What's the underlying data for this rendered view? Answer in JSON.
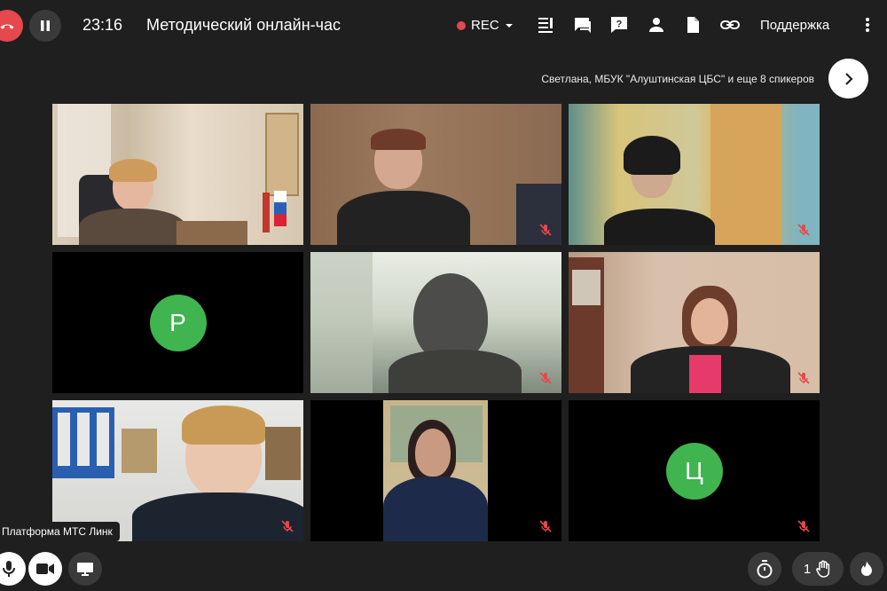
{
  "header": {
    "timer": "23:16",
    "title": "Методический онлайн-час",
    "rec_label": "REC",
    "support_label": "Поддержка",
    "icons": [
      "end-call-icon",
      "pause-icon",
      "chevron-down-icon",
      "participants-list-icon",
      "chat-icon",
      "question-icon",
      "person-icon",
      "document-icon",
      "link-icon",
      "more-vertical-icon"
    ]
  },
  "speakers_text": "Светлана, МБУК \"Алуштинская ЦБС\" и еще 8 спикеров",
  "tiles": [
    {
      "kind": "video",
      "speaking": true,
      "muted": false
    },
    {
      "kind": "video",
      "muted": true
    },
    {
      "kind": "video",
      "muted": true
    },
    {
      "kind": "avatar",
      "initial": "Р",
      "muted": false
    },
    {
      "kind": "video",
      "muted": true
    },
    {
      "kind": "video",
      "muted": true
    },
    {
      "kind": "video",
      "muted": true
    },
    {
      "kind": "video",
      "muted": true
    },
    {
      "kind": "avatar",
      "initial": "Ц",
      "muted": true
    }
  ],
  "platform_label": "Платформа МТС Линк",
  "footer": {
    "hand_count": "1",
    "icons": [
      "mic-icon",
      "camera-icon",
      "screen-share-icon",
      "timer-icon",
      "raise-hand-icon",
      "fire-icon"
    ]
  },
  "colors": {
    "background": "#1f1f1f",
    "rec": "#e5484d",
    "avatar": "#3fb44f",
    "active_border": "#3cc35a",
    "mute": "#e5484d"
  }
}
